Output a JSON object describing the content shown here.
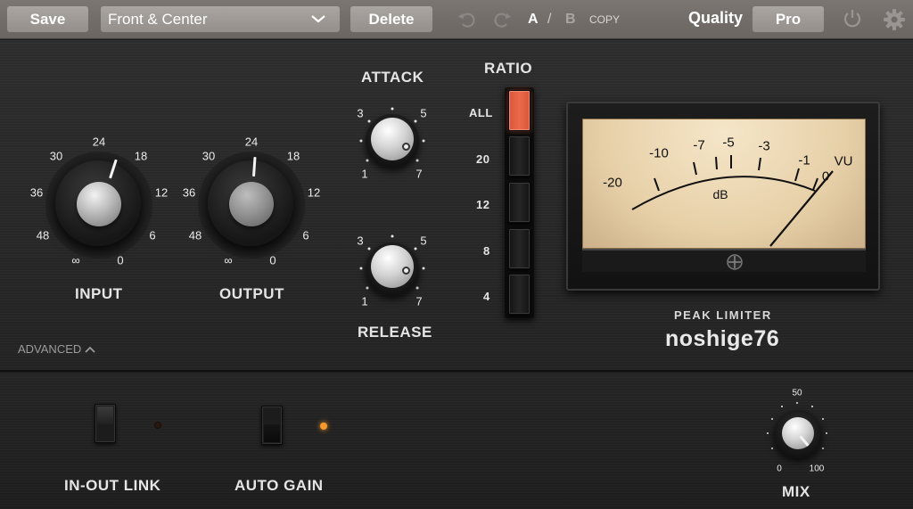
{
  "toolbar": {
    "save_label": "Save",
    "preset_value": "Front & Center",
    "delete_label": "Delete",
    "ab_a": "A",
    "ab_sep": "/",
    "ab_b": "B",
    "copy_label": "COPY",
    "quality_label": "Quality",
    "quality_value": "Pro"
  },
  "input_knob": {
    "label": "INPUT",
    "ticks": [
      "24",
      "18",
      "12",
      "6",
      "0",
      "∞",
      "48",
      "36",
      "30"
    ]
  },
  "output_knob": {
    "label": "OUTPUT",
    "ticks": [
      "24",
      "18",
      "12",
      "6",
      "0",
      "∞",
      "48",
      "36",
      "30"
    ]
  },
  "attack": {
    "label": "ATTACK",
    "ticks": [
      "3",
      "5",
      "1",
      "7"
    ]
  },
  "release": {
    "label": "RELEASE",
    "ticks": [
      "3",
      "5",
      "1",
      "7"
    ]
  },
  "ratio": {
    "label": "RATIO",
    "options": [
      "ALL",
      "20",
      "12",
      "8",
      "4"
    ],
    "selected": "ALL"
  },
  "vu_meter": {
    "scale": [
      "-20",
      "-10",
      "-7",
      "-5",
      "-3",
      "-1",
      "0"
    ],
    "unit": "dB",
    "badge": "VU"
  },
  "brand": {
    "subtitle": "PEAK LIMITER",
    "name": "noshige76"
  },
  "advanced_label": "ADVANCED",
  "in_out_link": {
    "label": "IN-OUT LINK",
    "state": "off"
  },
  "auto_gain": {
    "label": "AUTO GAIN",
    "state": "on"
  },
  "mix": {
    "label": "MIX",
    "ticks": [
      "50",
      "0",
      "100"
    ]
  },
  "colors": {
    "accent_red": "#ec6a4b",
    "led_orange": "#f59a2b",
    "vu_face": "#e7d0a8"
  }
}
